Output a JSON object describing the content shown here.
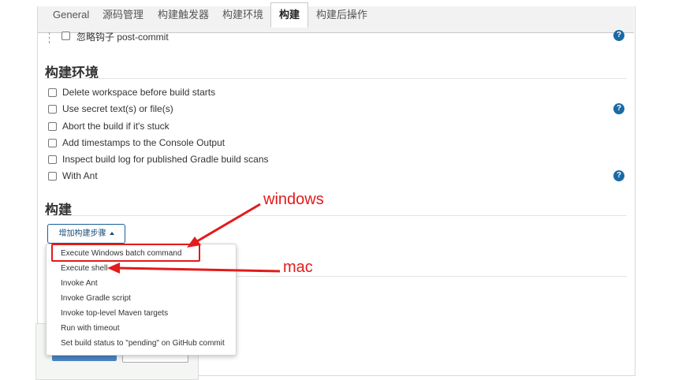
{
  "tabs": [
    {
      "label": "General"
    },
    {
      "label": "源码管理"
    },
    {
      "label": "构建触发器"
    },
    {
      "label": "构建环境"
    },
    {
      "label": "构建"
    },
    {
      "label": "构建后操作"
    }
  ],
  "top_option": {
    "label": "忽略钩子 post-commit"
  },
  "build_env": {
    "title": "构建环境",
    "options": [
      {
        "label": "Delete workspace before build starts"
      },
      {
        "label": "Use secret text(s) or file(s)"
      },
      {
        "label": "Abort the build if it's stuck"
      },
      {
        "label": "Add timestamps to the Console Output"
      },
      {
        "label": "Inspect build log for published Gradle build scans"
      },
      {
        "label": "With Ant"
      }
    ]
  },
  "build": {
    "title": "构建",
    "add_step_label": "增加构建步骤"
  },
  "dropdown_items": [
    {
      "label": "Execute Windows batch command"
    },
    {
      "label": "Execute shell"
    },
    {
      "label": "Invoke Ant"
    },
    {
      "label": "Invoke Gradle script"
    },
    {
      "label": "Invoke top-level Maven targets"
    },
    {
      "label": "Run with timeout"
    },
    {
      "label": "Set build status to \"pending\" on GitHub commit"
    }
  ],
  "annotations": {
    "windows": "windows",
    "mac": "mac",
    "color": "#e21b1b"
  },
  "help_icon": {
    "glyph": "?",
    "color": "#1a6aa5"
  },
  "accent_color": "#1a5f96"
}
